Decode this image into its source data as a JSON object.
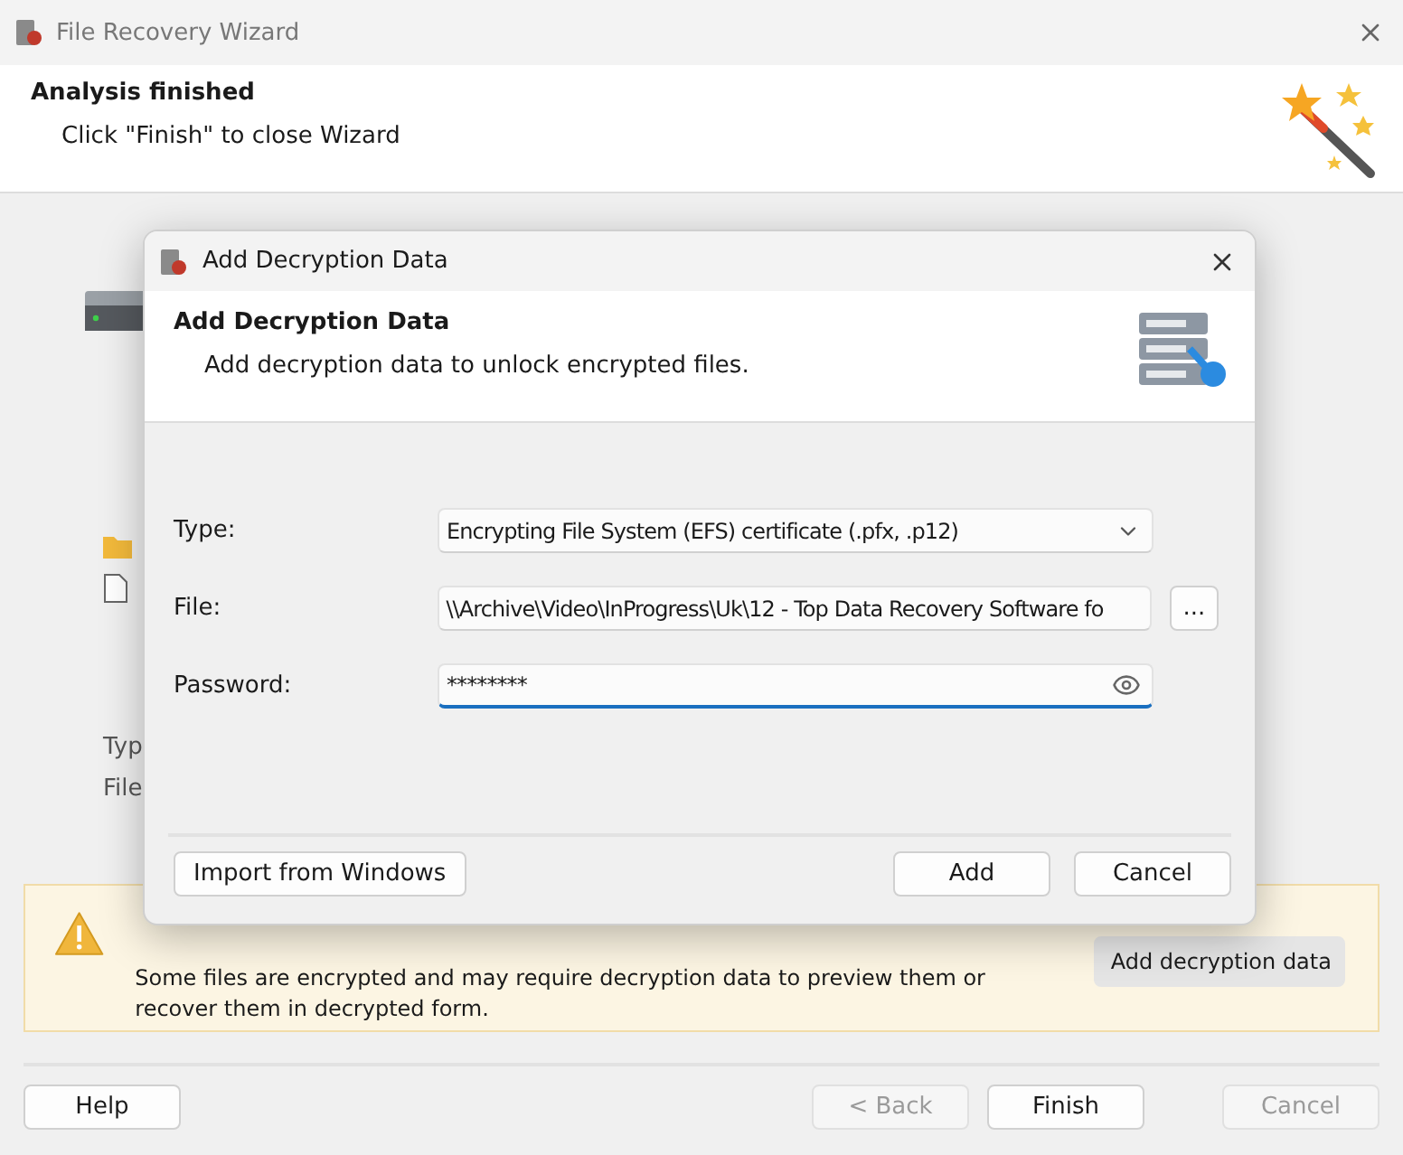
{
  "window": {
    "title": "File Recovery Wizard"
  },
  "header": {
    "title": "Analysis finished",
    "subtitle": "Click \"Finish\" to close Wizard"
  },
  "background_labels": [
    "Typ",
    "File"
  ],
  "notice": {
    "text": "Some files are encrypted and may require decryption data to preview them or recover them in decrypted form.",
    "button": "Add decryption data"
  },
  "footer_buttons": [
    {
      "label": "Help",
      "disabled": false
    },
    {
      "label": "< Back",
      "disabled": true
    },
    {
      "label": "Finish",
      "disabled": false
    },
    {
      "label": "Cancel",
      "disabled": true
    }
  ],
  "dialog": {
    "title": "Add Decryption Data",
    "header": {
      "title": "Add Decryption Data",
      "subtitle": "Add decryption data to unlock encrypted files."
    },
    "fields": [
      {
        "label": "Type:",
        "kind": "select",
        "value": "Encrypting File System (EFS) certificate (.pfx, .p12)",
        "focused": false
      },
      {
        "label": "File:",
        "kind": "file",
        "value": "\\\\Archive\\Video\\InProgress\\Uk\\12 - Top Data Recovery Software fo",
        "button": "...",
        "focused": false
      },
      {
        "label": "Password:",
        "kind": "password",
        "value": "********",
        "focused": true
      }
    ],
    "buttons": [
      {
        "label": "Import from Windows"
      },
      {
        "label": "Add"
      },
      {
        "label": "Cancel"
      }
    ]
  }
}
